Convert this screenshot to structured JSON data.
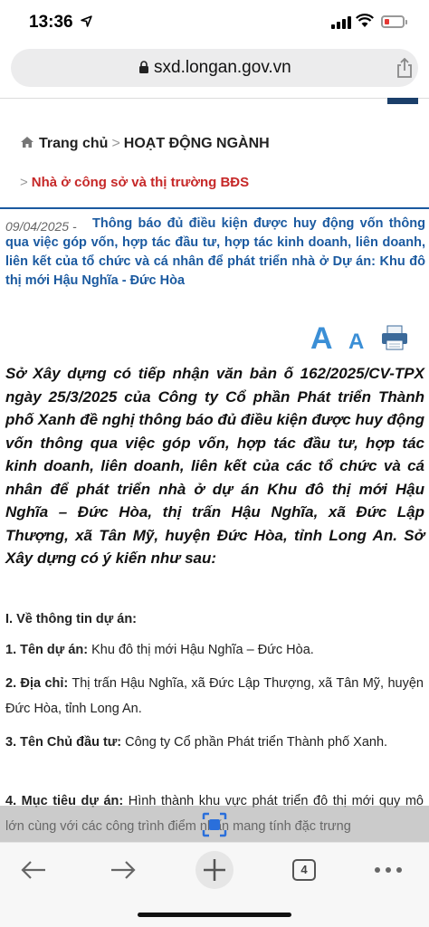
{
  "status": {
    "time": "13:36"
  },
  "browser": {
    "url": "sxd.longan.gov.vn",
    "tab_count": "4"
  },
  "breadcrumb": {
    "home": "Trang chủ",
    "section": "HOẠT ĐỘNG NGÀNH",
    "subsection": "Nhà ở công sở và thị trường BĐS",
    "separator": ">"
  },
  "article": {
    "date": "09/04/2025 -",
    "title": "Thông báo đủ điều kiện được huy động vốn thông qua việc góp vốn, hợp tác đầu tư, hợp tác kinh doanh, liên doanh, liên kết của tổ chức và cá nhân để phát triển nhà ở Dự án: Khu đô thị mới Hậu Nghĩa - Đức Hòa",
    "font_large": "A",
    "font_small": "A",
    "lead": "Sở Xây dựng có tiếp nhận văn bản ố 162/2025/CV-TPX ngày 25/3/2025  của Công ty Cổ phần Phát triển Thành phố Xanh đề nghị thông báo đủ điều kiện được huy động vốn thông qua việc góp vốn, hợp tác đầu tư, hợp tác kinh doanh, liên doanh, liên kết của các tổ chức và cá nhân để phát triển nhà ở dự án Khu đô thị mới Hậu Nghĩa – Đức Hòa, thị trấn Hậu Nghĩa, xã Đức Lập Thượng, xã Tân Mỹ, huyện Đức Hòa, tỉnh Long An. Sở Xây dựng có ý kiến như sau:",
    "section_heading": "I. Về thông tin dự án:",
    "items": [
      {
        "label": "1. Tên dự án:",
        "text": "Khu đô thị mới Hậu Nghĩa – Đức Hòa."
      },
      {
        "label": "2. Địa chỉ:",
        "text": "Thị trấn Hậu Nghĩa, xã Đức Lập Thượng, xã Tân Mỹ, huyện Đức Hòa, tỉnh Long An."
      },
      {
        "label": "3. Tên Chủ đầu tư:",
        "text": "Công ty Cổ phần Phát triển Thành phố Xanh."
      },
      {
        "label": "4. Mục tiêu dự án:",
        "text": "Hình thành khu vực phát triển đô thị mới quy mô lớn cùng với các công trình điểm nhấn mang tính đặc trưng"
      }
    ]
  },
  "colors": {
    "link_blue": "#1b5aa0",
    "crumb_red": "#c62828",
    "accent_blue": "#3b8fd6"
  }
}
